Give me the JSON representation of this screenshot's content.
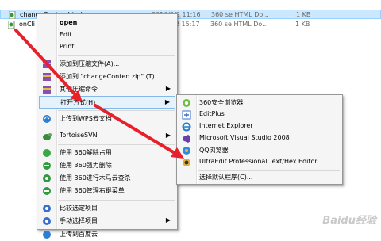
{
  "files": [
    {
      "name": "changeConten.html",
      "date": "2016/2/2 11:16",
      "type": "360 se HTML Do...",
      "size": "1 KB"
    },
    {
      "name": "onCli",
      "date": "2016/2/2 15:17",
      "type": "360 se HTML Do...",
      "size": "1 KB"
    }
  ],
  "context_menu": {
    "open": "open",
    "edit": "Edit",
    "print": "Print",
    "add_archive": "添加到压缩文件(A)...",
    "add_zip": "添加到 \"changeConten.zip\" (T)",
    "other_cmd": "其他压缩命令",
    "open_with": "打开方式(H)",
    "upload_wps": "上传到WPS云文档",
    "tortoise": "TortoiseSVN",
    "u360_unlock": "使用 360解除占用",
    "u360_delete": "使用 360强力删除",
    "u360_trojan": "使用 360进行木马云查杀",
    "u360_menu": "使用 360管理右键菜单",
    "compare": "比较选定项目",
    "compare_manual": "手动选择项目",
    "upload_baidu": "上传到百度云"
  },
  "open_with_menu": {
    "items": [
      "360安全浏览器",
      "EditPlus",
      "Internet Explorer",
      "Microsoft Visual Studio 2008",
      "QQ浏览器",
      "UltraEdit Professional Text/Hex Editor"
    ],
    "choose_default": "选择默认程序(C)..."
  },
  "watermark": "Baidu经验"
}
